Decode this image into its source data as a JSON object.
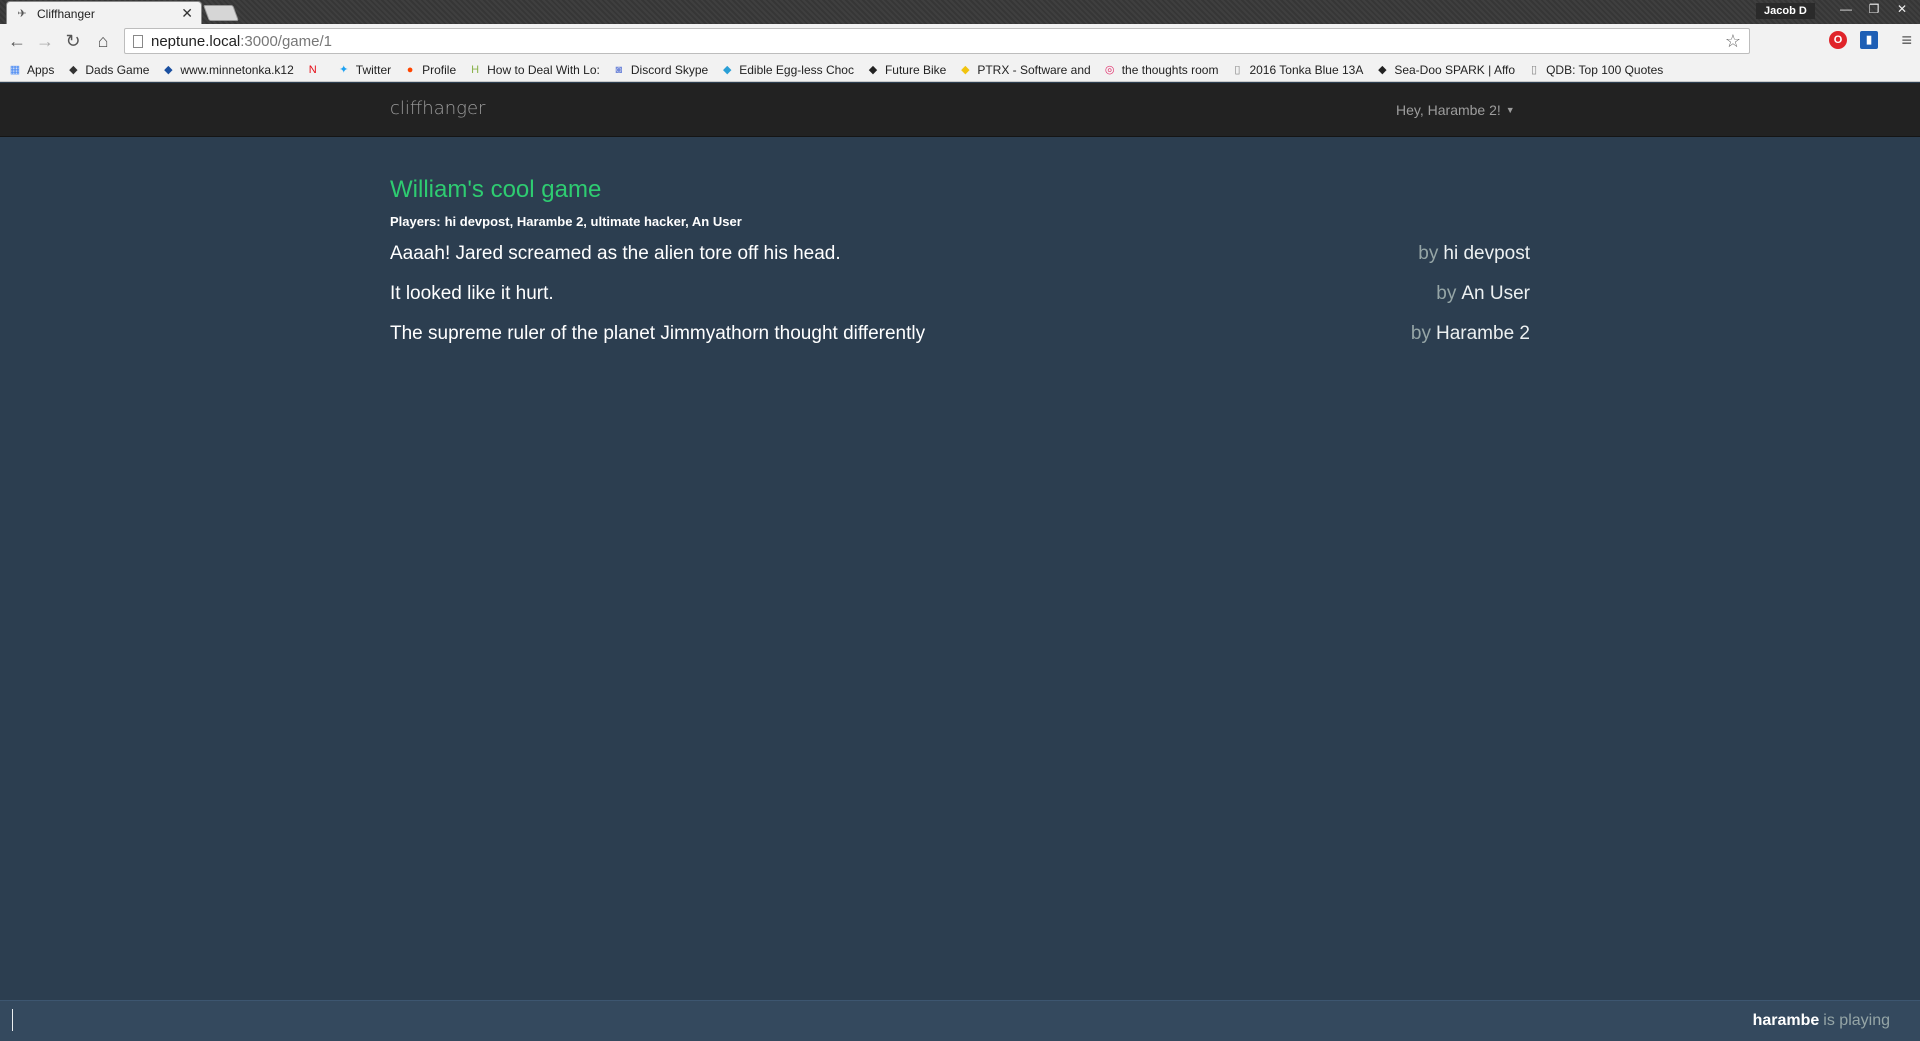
{
  "browser": {
    "tab_title": "Cliffhanger",
    "profile_name": "Jacob D",
    "url_host": "neptune.local",
    "url_path": ":3000/game/1",
    "bookmarks": [
      {
        "label": "Apps",
        "icon": "apps-grid-icon",
        "color": "#4285f4"
      },
      {
        "label": "Dads Game",
        "icon": "bookmark-icon",
        "color": "#333333"
      },
      {
        "label": "www.minnetonka.k12",
        "icon": "bookmark-icon",
        "color": "#1a4fa0"
      },
      {
        "label": "",
        "icon": "netflix-icon",
        "color": "#e50914"
      },
      {
        "label": "Twitter",
        "icon": "twitter-icon",
        "color": "#1da1f2"
      },
      {
        "label": "Profile",
        "icon": "reddit-icon",
        "color": "#ff4500"
      },
      {
        "label": "How to Deal With Lo:",
        "icon": "wikihow-icon",
        "color": "#8ab24c"
      },
      {
        "label": "Discord Skype",
        "icon": "discord-icon",
        "color": "#7289da"
      },
      {
        "label": "Edible Egg-less Choc",
        "icon": "bookmark-icon",
        "color": "#2a9fd6"
      },
      {
        "label": "Future Bike",
        "icon": "bookmark-icon",
        "color": "#222222"
      },
      {
        "label": "PTRX - Software and",
        "icon": "bookmark-icon",
        "color": "#f1c40f"
      },
      {
        "label": "the thoughts room",
        "icon": "instagram-icon",
        "color": "#e1306c"
      },
      {
        "label": "2016 Tonka Blue 13A",
        "icon": "page-icon",
        "color": "#888888"
      },
      {
        "label": "Sea-Doo SPARK | Affo",
        "icon": "bookmark-icon",
        "color": "#222222"
      },
      {
        "label": "QDB: Top 100 Quotes",
        "icon": "page-icon",
        "color": "#888888"
      }
    ]
  },
  "navbar": {
    "brand": "cliffhanger",
    "user_greeting": "Hey, Harambe 2!"
  },
  "game": {
    "title": "William's cool game",
    "players_label": "Players:",
    "players": "hi devpost, Harambe 2, ultimate hacker, An User",
    "by_label": "by",
    "lines": [
      {
        "text": "Aaaah! Jared screamed as the alien tore off his head.",
        "author": "hi devpost"
      },
      {
        "text": "It looked like it hurt.",
        "author": "An User"
      },
      {
        "text": "The supreme ruler of the planet Jimmyathorn thought differently",
        "author": "Harambe 2"
      }
    ]
  },
  "footer": {
    "player": "harambe",
    "status": "is playing"
  }
}
